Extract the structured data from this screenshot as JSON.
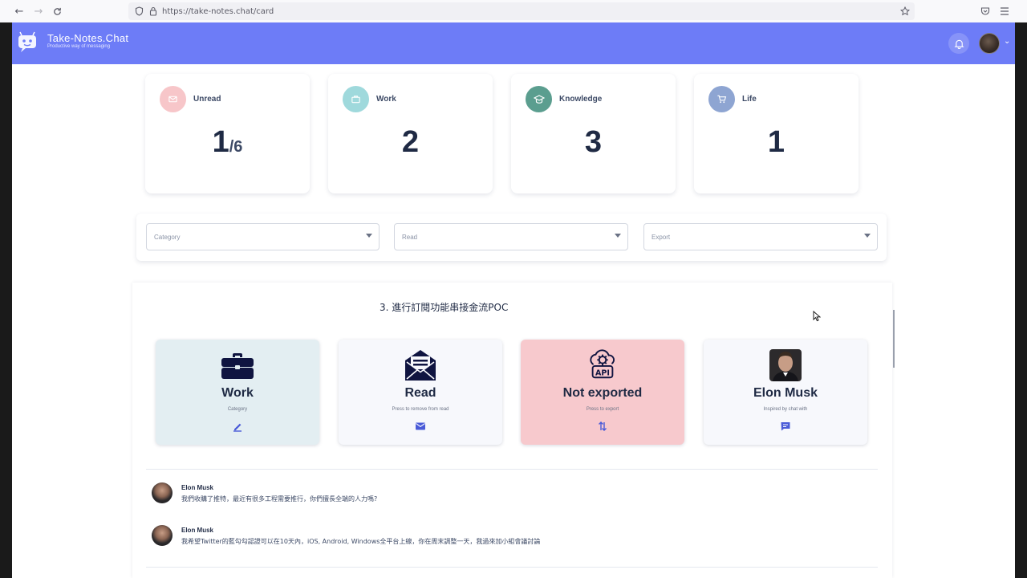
{
  "browser": {
    "url": "https://take-notes.chat/card"
  },
  "header": {
    "brand": "Take-Notes.Chat",
    "tagline": "Productive  way of messaging"
  },
  "stats": [
    {
      "label": "Unread",
      "value": "1",
      "total": "/6",
      "icon": "mail-icon",
      "color": "#f7c6c9"
    },
    {
      "label": "Work",
      "value": "2",
      "icon": "briefcase-icon",
      "color": "#9fd9dc"
    },
    {
      "label": "Knowledge",
      "value": "3",
      "icon": "graduation-cap-icon",
      "color": "#5b9e8f"
    },
    {
      "label": "Life",
      "value": "1",
      "icon": "cart-icon",
      "color": "#8ea5d2"
    }
  ],
  "filters": {
    "category_placeholder": "Category",
    "read_placeholder": "Read",
    "export_placeholder": "Export"
  },
  "note": {
    "line": "3. 進行訂閱功能串接金流POC"
  },
  "actions": [
    {
      "title": "Work",
      "subtitle": "Category",
      "icon": "briefcase-icon",
      "button_icon": "edit-icon"
    },
    {
      "title": "Read",
      "subtitle": "Press to remove from read",
      "icon": "envelope-open-icon",
      "button_icon": "mail-icon"
    },
    {
      "title": "Not exported",
      "subtitle": "Press to export",
      "icon": "api-cloud-icon",
      "button_icon": "transfer-icon"
    },
    {
      "title": "Elon Musk",
      "subtitle": "Inspired by chat with",
      "icon": "avatar",
      "button_icon": "chat-icon"
    }
  ],
  "messages": [
    {
      "author": "Elon Musk",
      "text": "我們收購了推特，最近有很多工程需要推行，你們擅長全端的人力嗎?"
    },
    {
      "author": "Elon Musk",
      "text": "我希望Twitter的藍勾勾認證可以在10天內，iOS, Android, Windows全平台上線，你在周末調整一天，我過來加小組會議討論"
    }
  ],
  "colors": {
    "header": "#6d7cf7",
    "work_card": "#e3eef2",
    "export_card": "#f7c9cd",
    "icon_dark": "#0f1440"
  }
}
